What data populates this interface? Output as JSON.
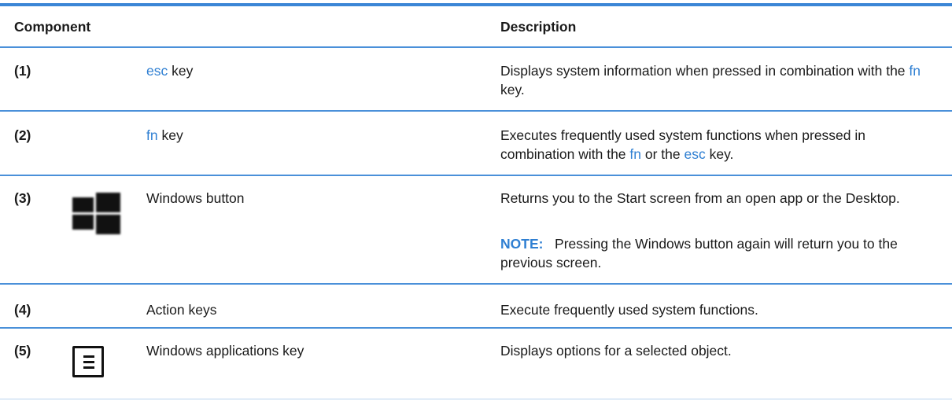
{
  "header": {
    "component": "Component",
    "description": "Description"
  },
  "rows": [
    {
      "num": "(1)",
      "name_key": "esc",
      "name_rest": " key",
      "desc_parts": [
        "Displays system information when pressed in combination with the ",
        "fn",
        " key."
      ]
    },
    {
      "num": "(2)",
      "name_key": "fn",
      "name_rest": " key",
      "desc_parts": [
        "Executes frequently used system functions when pressed in combination with the ",
        "fn",
        " or the ",
        "esc",
        " key."
      ]
    },
    {
      "num": "(3)",
      "icon": "windows-logo-icon",
      "name": "Windows button",
      "desc": "Returns you to the Start screen from an open app or the Desktop.",
      "note_label": "NOTE:",
      "note_text": "Pressing the Windows button again will return you to the previous screen."
    },
    {
      "num": "(4)",
      "name": "Action keys",
      "desc": "Execute frequently used system functions."
    },
    {
      "num": "(5)",
      "icon": "windows-applications-key-icon",
      "name": "Windows applications key",
      "desc": "Displays options for a selected object."
    }
  ],
  "colors": {
    "rule": "#4a90d9",
    "key_highlight": "#2f7fd2",
    "text": "#1a1a1a"
  }
}
